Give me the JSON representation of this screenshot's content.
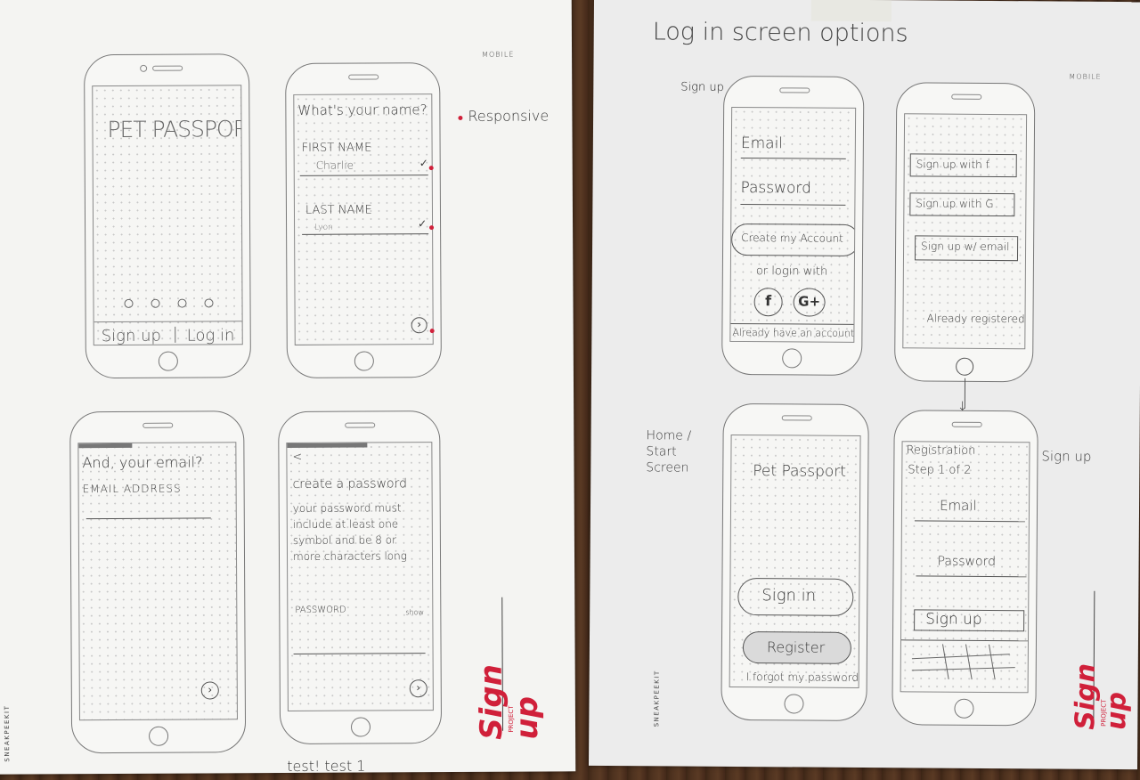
{
  "left_sheet": {
    "brand": "MOBILE",
    "side_note": "Responsive",
    "footer_note": "test! test 1",
    "sheet_label": "Sign up",
    "project_label": "PROJECT",
    "vertical_brand": "SNEAKPEEKIT",
    "screens": {
      "splash": {
        "title": "PET PASSPORT",
        "tab_signup": "Sign up",
        "tab_divider": "|",
        "tab_login": "Log in"
      },
      "name": {
        "question": "What's your name?",
        "first_label": "FIRST NAME",
        "first_value": "Charlie",
        "last_label": "LAST NAME",
        "last_value": "Lyon",
        "check": "✓",
        "next": "›"
      },
      "email": {
        "question": "And, your email?",
        "field_label": "EMAIL ADDRESS",
        "next": "›"
      },
      "password": {
        "back": "<",
        "title": "create a password",
        "hint": "your password must include at least one symbol and be 8 or more characters long",
        "field_label": "PASSWORD",
        "show": "show",
        "next": "›"
      }
    }
  },
  "right_sheet": {
    "heading": "Log in screen options",
    "brand": "MOBILE",
    "vertical_brand": "SNEAKPEEKIT",
    "sheet_label": "Sign up",
    "project_label": "PROJECT",
    "annotation_signup_top": "Sign up",
    "annotation_home": "Home / Start Screen",
    "annotation_signup_right": "Sign up",
    "screens": {
      "login": {
        "email": "Email",
        "password": "Password",
        "create_button": "Create my Account",
        "or_login": "or login with",
        "facebook": "f",
        "google": "G+",
        "footer": "Already have an account"
      },
      "social": {
        "facebook_button": "Sign up with f",
        "google_button": "Sign up with G",
        "email_button": "Sign up w/ email",
        "registered": "Already registered?"
      },
      "home": {
        "title": "Pet Passport",
        "signin": "Sign in",
        "register": "Register",
        "forgot": "I forgot my password"
      },
      "registration": {
        "title": "Registration",
        "step": "Step 1 of 2",
        "email": "Email",
        "password": "Password",
        "signup": "Sign up"
      }
    }
  }
}
